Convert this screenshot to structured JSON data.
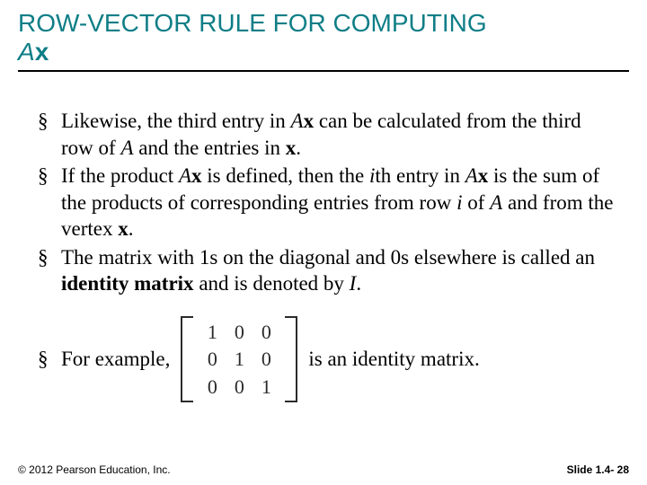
{
  "title_line1": "ROW-VECTOR RULE FOR COMPUTING",
  "title_A": "A",
  "title_x": "x",
  "bullets": [
    {
      "pre": "Likewise, the third entry in ",
      "AxA": "A",
      "Axx": "x",
      "mid1": " can be calculated from the third row of ",
      "A2": "A",
      "mid2": " and the entries in ",
      "x2": "x",
      "tail": "."
    },
    {
      "pre": "If the product ",
      "AxA": "A",
      "Axx": "x",
      "mid1": " is defined, then the ",
      "i1": "i",
      "mid2": "th entry in ",
      "AxA2": "A",
      "Axx2": "x",
      "mid3": " is the sum of the products of corresponding entries from row ",
      "i2": "i",
      "mid4": " of ",
      "A2": "A",
      "mid5": " and from the vertex ",
      "x2": "x",
      "tail": "."
    },
    {
      "pre": "The matrix with 1s on the diagonal and 0s elsewhere is called an ",
      "b1": "identity matrix",
      "mid1": " and is denoted by ",
      "I": "I",
      "tail": "."
    }
  ],
  "example_lead": "For example,",
  "example_tail": "is an identity matrix.",
  "matrix": [
    [
      "1",
      "0",
      "0"
    ],
    [
      "0",
      "1",
      "0"
    ],
    [
      "0",
      "0",
      "1"
    ]
  ],
  "footer_left": "© 2012 Pearson Education, Inc.",
  "footer_right": "Slide 1.4- 28"
}
